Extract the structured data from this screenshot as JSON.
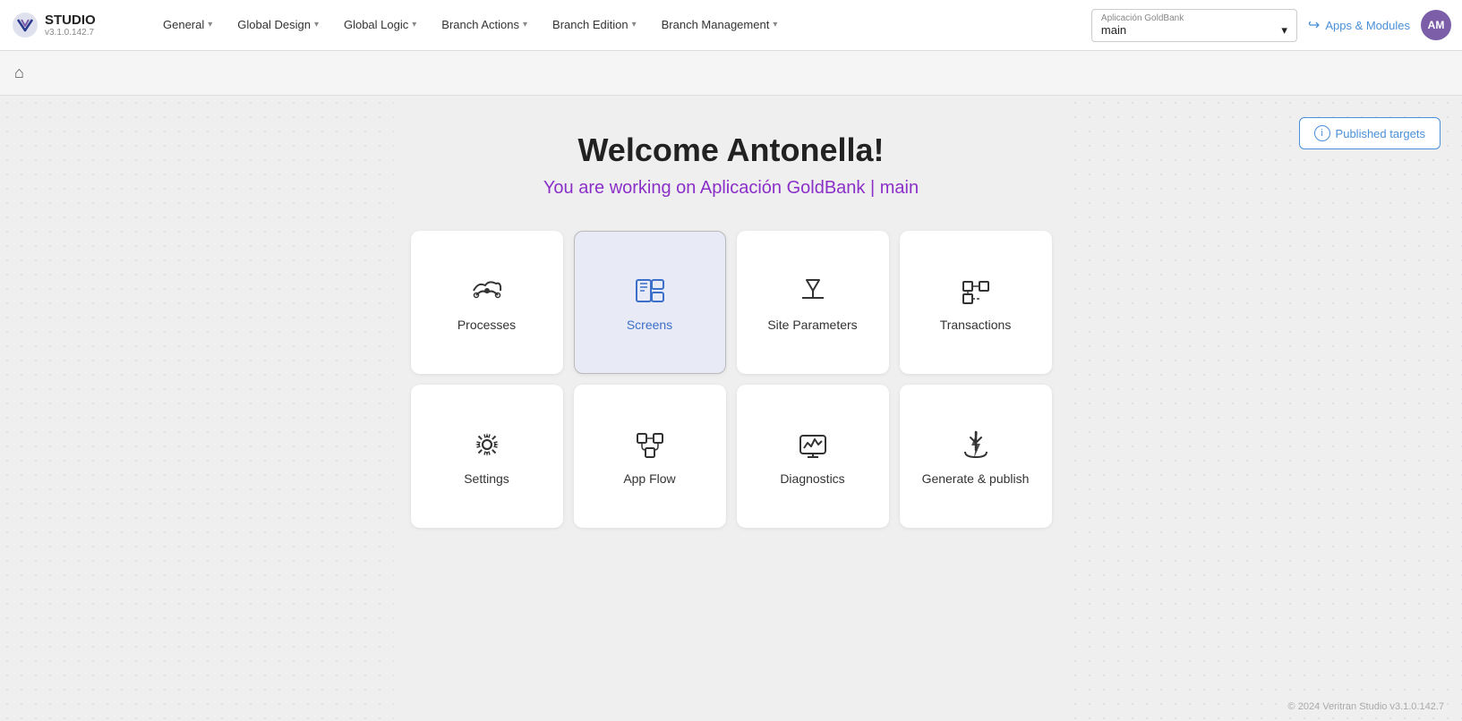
{
  "logo": {
    "studio_label": "STUDIO",
    "version": "v3.1.0.142.7"
  },
  "navbar": {
    "items": [
      {
        "id": "general",
        "label": "General"
      },
      {
        "id": "global-design",
        "label": "Global Design"
      },
      {
        "id": "global-logic",
        "label": "Global Logic"
      },
      {
        "id": "branch-actions",
        "label": "Branch Actions"
      },
      {
        "id": "branch-edition",
        "label": "Branch Edition"
      },
      {
        "id": "branch-management",
        "label": "Branch Management"
      }
    ],
    "app_selector_label": "Aplicación GoldBank",
    "app_selector_value": "main",
    "apps_modules_label": "Apps & Modules",
    "avatar_initials": "AM"
  },
  "published_targets_label": "Published targets",
  "welcome": {
    "title": "Welcome Antonella!",
    "subtitle": "You are working on Aplicación GoldBank | main"
  },
  "cards": [
    {
      "id": "processes",
      "label": "Processes",
      "icon": "process"
    },
    {
      "id": "screens",
      "label": "Screens",
      "icon": "screens",
      "highlighted": true
    },
    {
      "id": "site-parameters",
      "label": "Site Parameters",
      "icon": "site-params"
    },
    {
      "id": "transactions",
      "label": "Transactions",
      "icon": "transactions"
    },
    {
      "id": "settings",
      "label": "Settings",
      "icon": "settings"
    },
    {
      "id": "app-flow",
      "label": "App Flow",
      "icon": "app-flow"
    },
    {
      "id": "diagnostics",
      "label": "Diagnostics",
      "icon": "diagnostics"
    },
    {
      "id": "generate-publish",
      "label": "Generate & publish",
      "icon": "generate-publish"
    }
  ],
  "footer": "© 2024 Veritran Studio v3.1.0.142.7"
}
